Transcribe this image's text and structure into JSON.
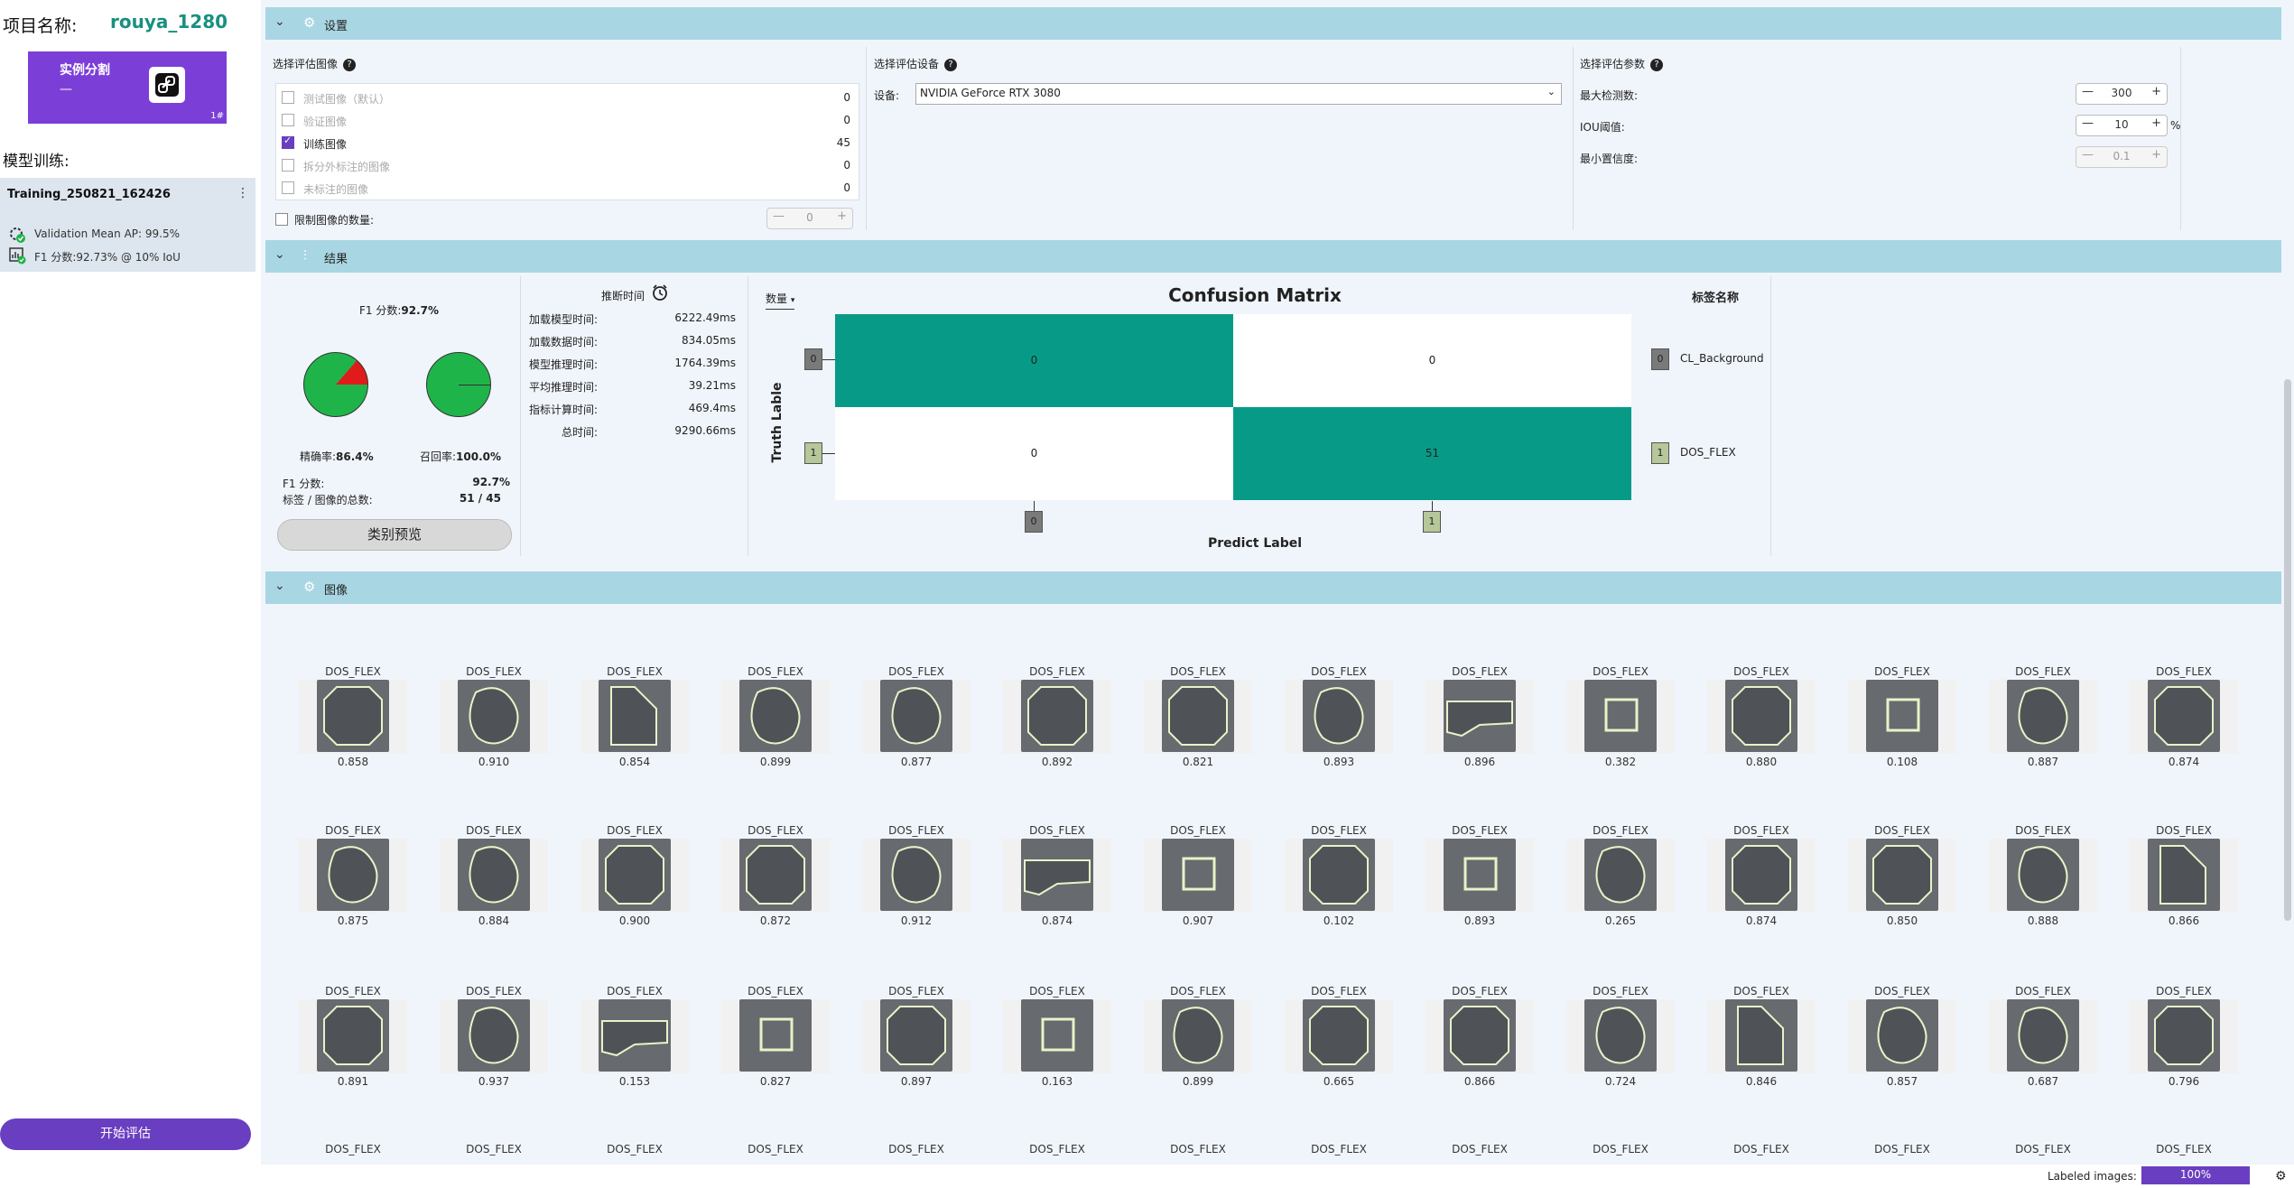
{
  "sidebar": {
    "project_label": "项目名称:",
    "project_name": "rouya_1280",
    "card": {
      "title": "实例分割",
      "dash": "—",
      "num": "1#"
    },
    "model_title": "模型训练:",
    "training_name": "Training_250821_162426",
    "menu": "⋮",
    "validation_map": "Validation Mean AP: 99.5%",
    "f1_line": "F1 分数:92.73% @ 10% IoU",
    "start_button": "开始评估"
  },
  "settings": {
    "header": "设置",
    "image_select_label": "选择评估图像",
    "image_rows": [
      {
        "label": "测试图像（默认）",
        "count": "0",
        "checked": false
      },
      {
        "label": "验证图像",
        "count": "0",
        "checked": false
      },
      {
        "label": "训练图像",
        "count": "45",
        "checked": true
      },
      {
        "label": "拆分外标注的图像",
        "count": "0",
        "checked": false
      },
      {
        "label": "未标注的图像",
        "count": "0",
        "checked": false
      }
    ],
    "limit_label": "限制图像的数量:",
    "limit_value": "0",
    "device_select_label": "选择评估设备",
    "device_label": "设备:",
    "device_value": "NVIDIA GeForce RTX 3080",
    "param_label": "选择评估参数",
    "params": [
      {
        "label": "最大检测数:",
        "value": "300",
        "unit": ""
      },
      {
        "label": "IOU阈值:",
        "value": "10",
        "unit": "%"
      },
      {
        "label": "最小置信度:",
        "value": "0.1",
        "unit": ""
      }
    ]
  },
  "results": {
    "header": "结果",
    "f1_title": "F1 分数:",
    "f1_value": "92.7%",
    "precision_label": "精确率:",
    "precision_value": "86.4%",
    "precision_fraction": 0.864,
    "recall_label": "召回率:",
    "recall_value": "100.0%",
    "recall_fraction": 1.0,
    "f1_label2": "F1 分数:",
    "f1_value2": "92.7%",
    "label_count_label": "标签 / 图像的总数:",
    "label_count_value": "51 / 45",
    "preview_button": "类别预览",
    "timing_title": "推断时间",
    "timings": [
      {
        "label": "加载模型时间:",
        "value": "6222.49",
        "unit": "ms"
      },
      {
        "label": "加载数据时间:",
        "value": "834.05",
        "unit": "ms"
      },
      {
        "label": "模型推理时间:",
        "value": "1764.39",
        "unit": "ms"
      },
      {
        "label": "平均推理时间:",
        "value": "39.21",
        "unit": "ms"
      },
      {
        "label": "指标计算时间:",
        "value": "469.4",
        "unit": "ms"
      },
      {
        "label": "总时间:",
        "value": "9290.66",
        "unit": "ms"
      }
    ],
    "cm_mode": "数量",
    "cm_title": "Confusion  Matrix",
    "cm_ylabel": "Truth  Lable",
    "cm_xlabel": "Predict  Label",
    "cm_cells": [
      "0",
      "0",
      "0",
      "51"
    ],
    "cm_row_tags": [
      "0",
      "1"
    ],
    "cm_col_tags": [
      "0",
      "1"
    ],
    "legend_title": "标签名称",
    "legend": [
      {
        "id": "0",
        "name": "CL_Background"
      },
      {
        "id": "1",
        "name": "DOS_FLEX"
      }
    ]
  },
  "images": {
    "header": "图像",
    "rows": [
      {
        "label": "DOS_FLEX",
        "scores": [
          "0.858",
          "0.910",
          "0.854",
          "0.899",
          "0.877",
          "0.892",
          "0.821",
          "0.893",
          "0.896",
          "0.382",
          "0.880",
          "0.108",
          "0.887",
          "0.874"
        ]
      },
      {
        "label": "DOS_FLEX",
        "scores": [
          "0.875",
          "0.884",
          "0.900",
          "0.872",
          "0.912",
          "0.874",
          "0.907",
          "0.102",
          "0.893",
          "0.265",
          "0.874",
          "0.850",
          "0.888",
          "0.866"
        ]
      },
      {
        "label": "DOS_FLEX",
        "scores": [
          "0.891",
          "0.937",
          "0.153",
          "0.827",
          "0.897",
          "0.163",
          "0.899",
          "0.665",
          "0.866",
          "0.724",
          "0.846",
          "0.857",
          "0.687",
          "0.796"
        ]
      },
      {
        "label": "DOS_FLEX",
        "scores": []
      }
    ]
  },
  "status": {
    "labeled_label": "Labeled images:",
    "labeled_value": "100%",
    "labeled_fraction": 1.0
  },
  "colors": {
    "accent": "#6a3ec0",
    "teal": "#079b87",
    "header": "#a9d6e3",
    "pie_green": "#1fb44a",
    "pie_red": "#e11b1b"
  }
}
